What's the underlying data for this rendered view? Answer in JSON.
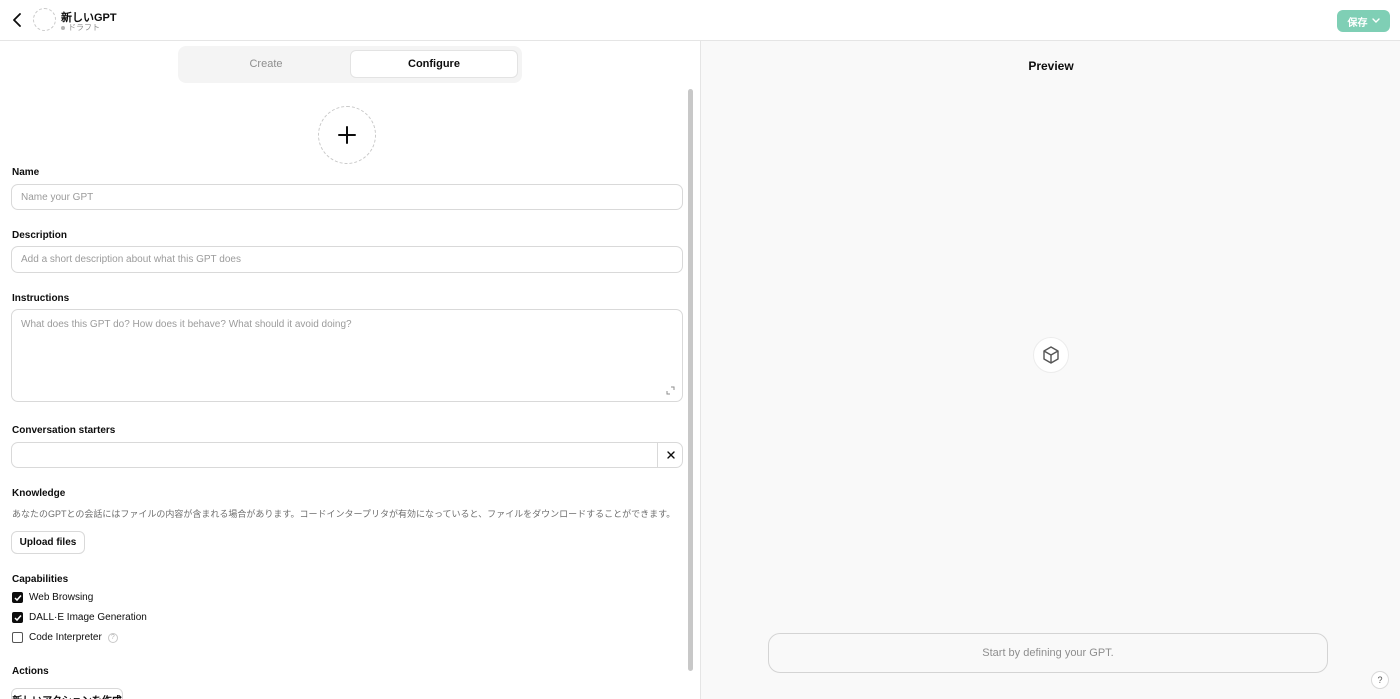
{
  "header": {
    "gpt_name": "新しいGPT",
    "status": "ドラフト",
    "save_label": "保存",
    "save_color": "#7fcfb5"
  },
  "tabs": [
    {
      "label": "Create",
      "active": false
    },
    {
      "label": "Configure",
      "active": true
    }
  ],
  "form": {
    "name": {
      "label": "Name",
      "placeholder": "Name your GPT"
    },
    "description": {
      "label": "Description",
      "placeholder": "Add a short description about what this GPT does"
    },
    "instructions": {
      "label": "Instructions",
      "placeholder": "What does this GPT do? How does it behave? What should it avoid doing?"
    },
    "conversation_starters": {
      "label": "Conversation starters",
      "value": ""
    },
    "knowledge": {
      "label": "Knowledge",
      "text": "あなたのGPTとの会話にはファイルの内容が含まれる場合があります。コードインタープリタが有効になっていると、ファイルをダウンロードすることができます。",
      "upload_label": "Upload files"
    },
    "capabilities": {
      "label": "Capabilities",
      "items": [
        {
          "label": "Web Browsing",
          "checked": true
        },
        {
          "label": "DALL·E Image Generation",
          "checked": true
        },
        {
          "label": "Code Interpreter",
          "checked": false
        }
      ]
    },
    "actions": {
      "label": "Actions",
      "button_label": "新しいアクションを作成"
    }
  },
  "preview": {
    "title": "Preview",
    "input_placeholder": "Start by defining your GPT.",
    "help_label": "?"
  },
  "icons": [
    "back-icon",
    "chevron-down-icon",
    "plus-icon",
    "expand-icon",
    "close-icon",
    "checkmark-icon",
    "help-icon",
    "cube-icon"
  ]
}
